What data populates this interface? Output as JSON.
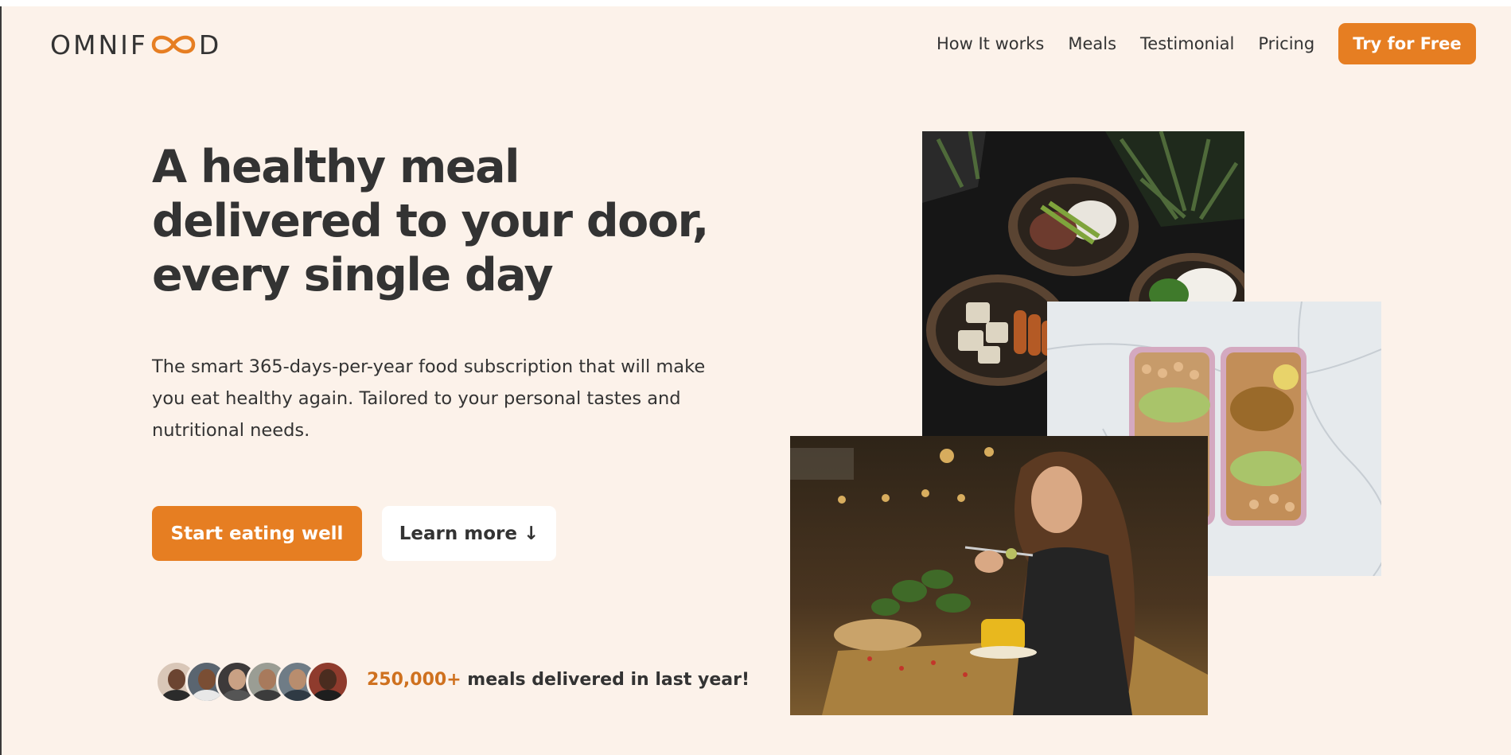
{
  "header": {
    "logo_left": "OMNIF",
    "logo_right": "D",
    "nav": [
      "How It works",
      "Meals",
      "Testimonial",
      "Pricing"
    ],
    "cta": "Try for Free"
  },
  "hero": {
    "headline_lines": [
      "A healthy meal",
      "delivered to your door,",
      "every single day"
    ],
    "description": "The smart 365-days-per-year food subscription that will make you eat healthy again. Tailored to your personal tastes and nutritional needs.",
    "primary_button": "Start eating well",
    "secondary_button": "Learn more ↓",
    "proof_number": "250,000+",
    "proof_text": " meals delivered in last year!"
  },
  "colors": {
    "accent": "#e67e22",
    "background": "#fcf2ea",
    "text": "#333333"
  },
  "icons": {
    "logo_mark": "infinity-icon"
  }
}
